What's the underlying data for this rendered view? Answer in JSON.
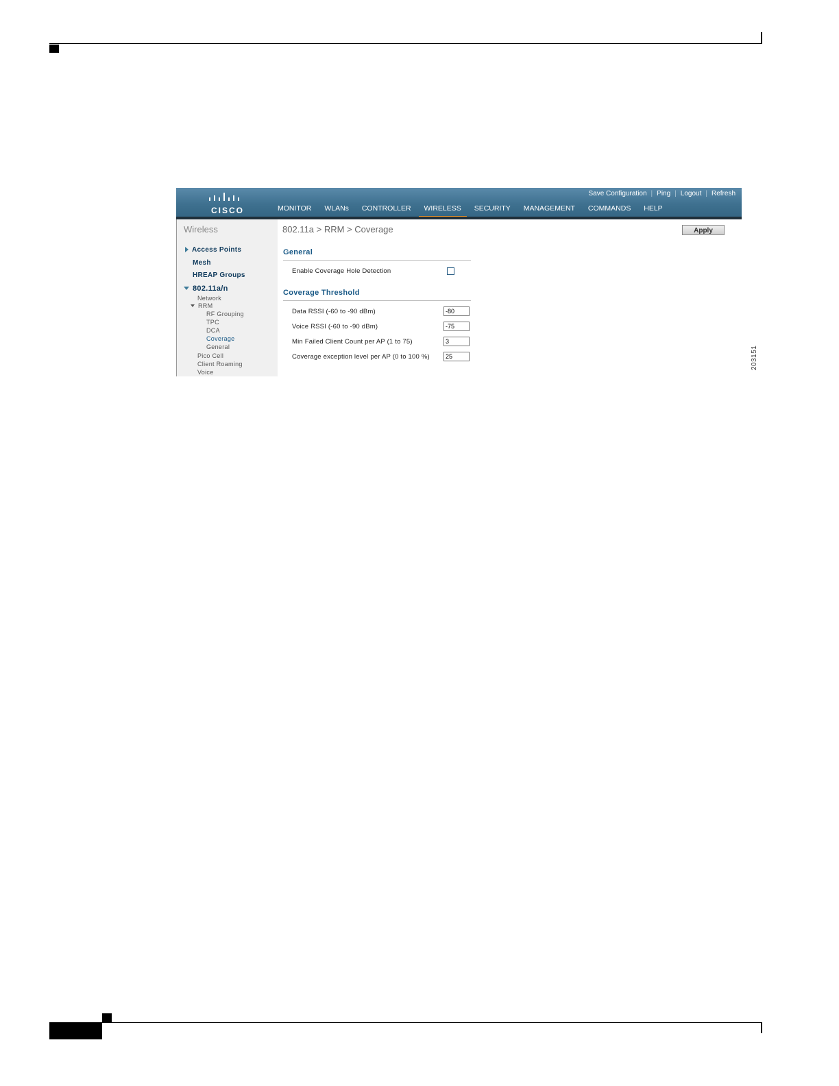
{
  "colors": {
    "header": "#3f7190",
    "nav_active_underline": "#f29a2e",
    "link_blue": "#1a5a87"
  },
  "header": {
    "logo_text": "CISCO",
    "top_links": [
      "Save Configuration",
      "Ping",
      "Logout",
      "Refresh"
    ],
    "nav": [
      "MONITOR",
      "WLANs",
      "CONTROLLER",
      "WIRELESS",
      "SECURITY",
      "MANAGEMENT",
      "COMMANDS",
      "HELP"
    ],
    "active_nav": "WIRELESS"
  },
  "sidebar": {
    "title": "Wireless",
    "items": {
      "access_points": "Access Points",
      "mesh": "Mesh",
      "hreap_groups": "HREAP Groups",
      "radio": "802.11a/n",
      "network": "Network",
      "rrm": "RRM",
      "rf_grouping": "RF Grouping",
      "tpc": "TPC",
      "dca": "DCA",
      "coverage": "Coverage",
      "general": "General",
      "pico_cell": "Pico Cell",
      "client_roaming": "Client Roaming",
      "voice": "Voice"
    }
  },
  "main": {
    "title": "802.11a > RRM > Coverage",
    "apply_label": "Apply",
    "general_title": "General",
    "coverage_hole_label": "Enable Coverage Hole Detection",
    "coverage_hole_checked": false,
    "threshold_title": "Coverage Threshold",
    "fields": [
      {
        "label": "Data RSSI (-60 to -90 dBm)",
        "value": "-80"
      },
      {
        "label": "Voice RSSI (-60 to -90 dBm)",
        "value": "-75"
      },
      {
        "label": "Min Failed Client Count per AP (1 to 75)",
        "value": "3"
      },
      {
        "label": "Coverage exception level per AP (0 to 100 %)",
        "value": "25"
      }
    ]
  },
  "figure_id": "203151"
}
